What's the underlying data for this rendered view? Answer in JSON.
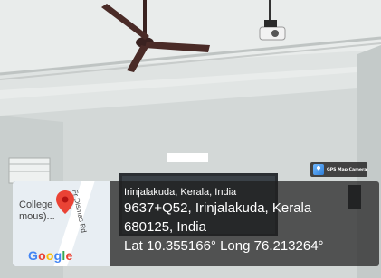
{
  "photo": {
    "description_icons": [
      "ceiling-fan",
      "projector",
      "projection-screen",
      "tube-light"
    ]
  },
  "badge": {
    "text": "GPS Map Camera",
    "icon": "gps-map-camera-icon"
  },
  "map": {
    "road_label": "Fr Dismas Rd",
    "place_label_line1": "College",
    "place_label_line2": "mous)...",
    "logo_text": "Google",
    "pin_color": "#EA4335"
  },
  "location": {
    "place": "Irinjalakuda, Kerala, India",
    "address_line1": "9637+Q52, Irinjalakuda, Kerala",
    "address_line2": "680125, India",
    "coordinates": "Lat 10.355166° Long 76.213264°"
  }
}
